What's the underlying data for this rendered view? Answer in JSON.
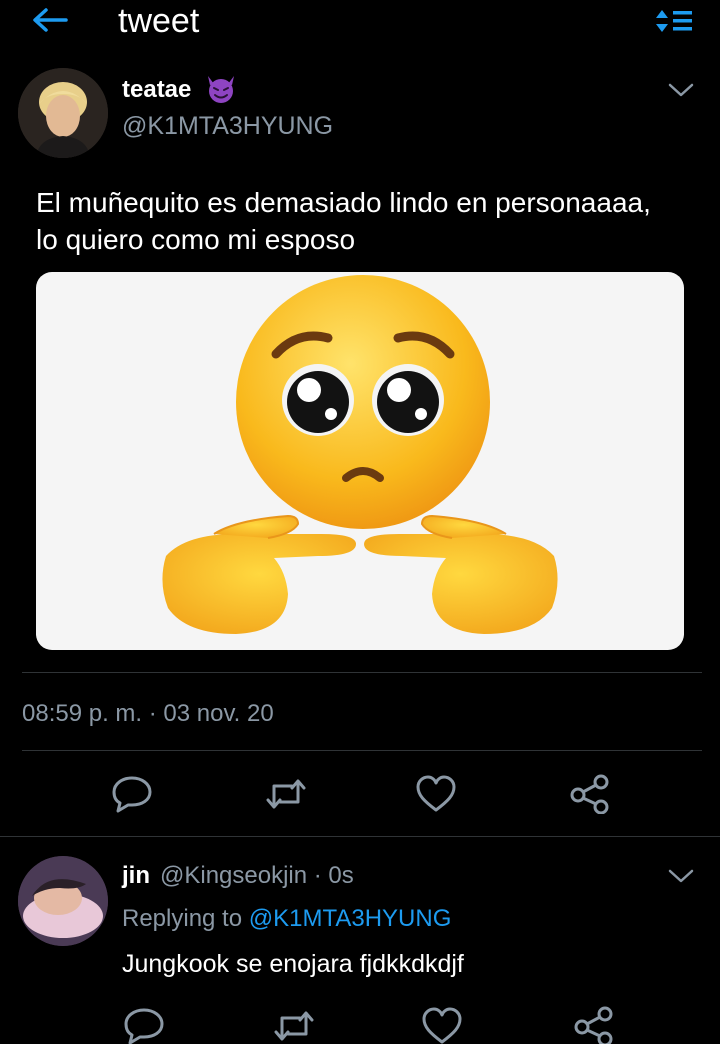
{
  "header": {
    "title": "tweet",
    "back_icon": "back-arrow-icon",
    "sort_icon": "sort-icon",
    "accent_color": "#1d9bf0"
  },
  "tweet": {
    "author_name": "teatae",
    "author_emoji": "devil-emoji",
    "author_handle": "@K1MTA3HYUNG",
    "text": "El muñequito es demasiado lindo en personaaaa, lo quiero como mi esposo",
    "media_icon": "pleading-face-pointing-fingers-emoji",
    "timestamp": "08:59 p. m. · 03 nov. 20",
    "actions": [
      "reply-icon",
      "retweet-icon",
      "like-icon",
      "share-icon"
    ]
  },
  "reply": {
    "author_name": "jin",
    "author_handle": "@Kingseokjin · 0s",
    "replying_prefix": "Replying to ",
    "replying_to": "@K1MTA3HYUNG",
    "text": "Jungkook se enojara fjdkkdkdjf",
    "actions": [
      "reply-icon",
      "retweet-icon",
      "like-icon",
      "share-icon"
    ]
  }
}
